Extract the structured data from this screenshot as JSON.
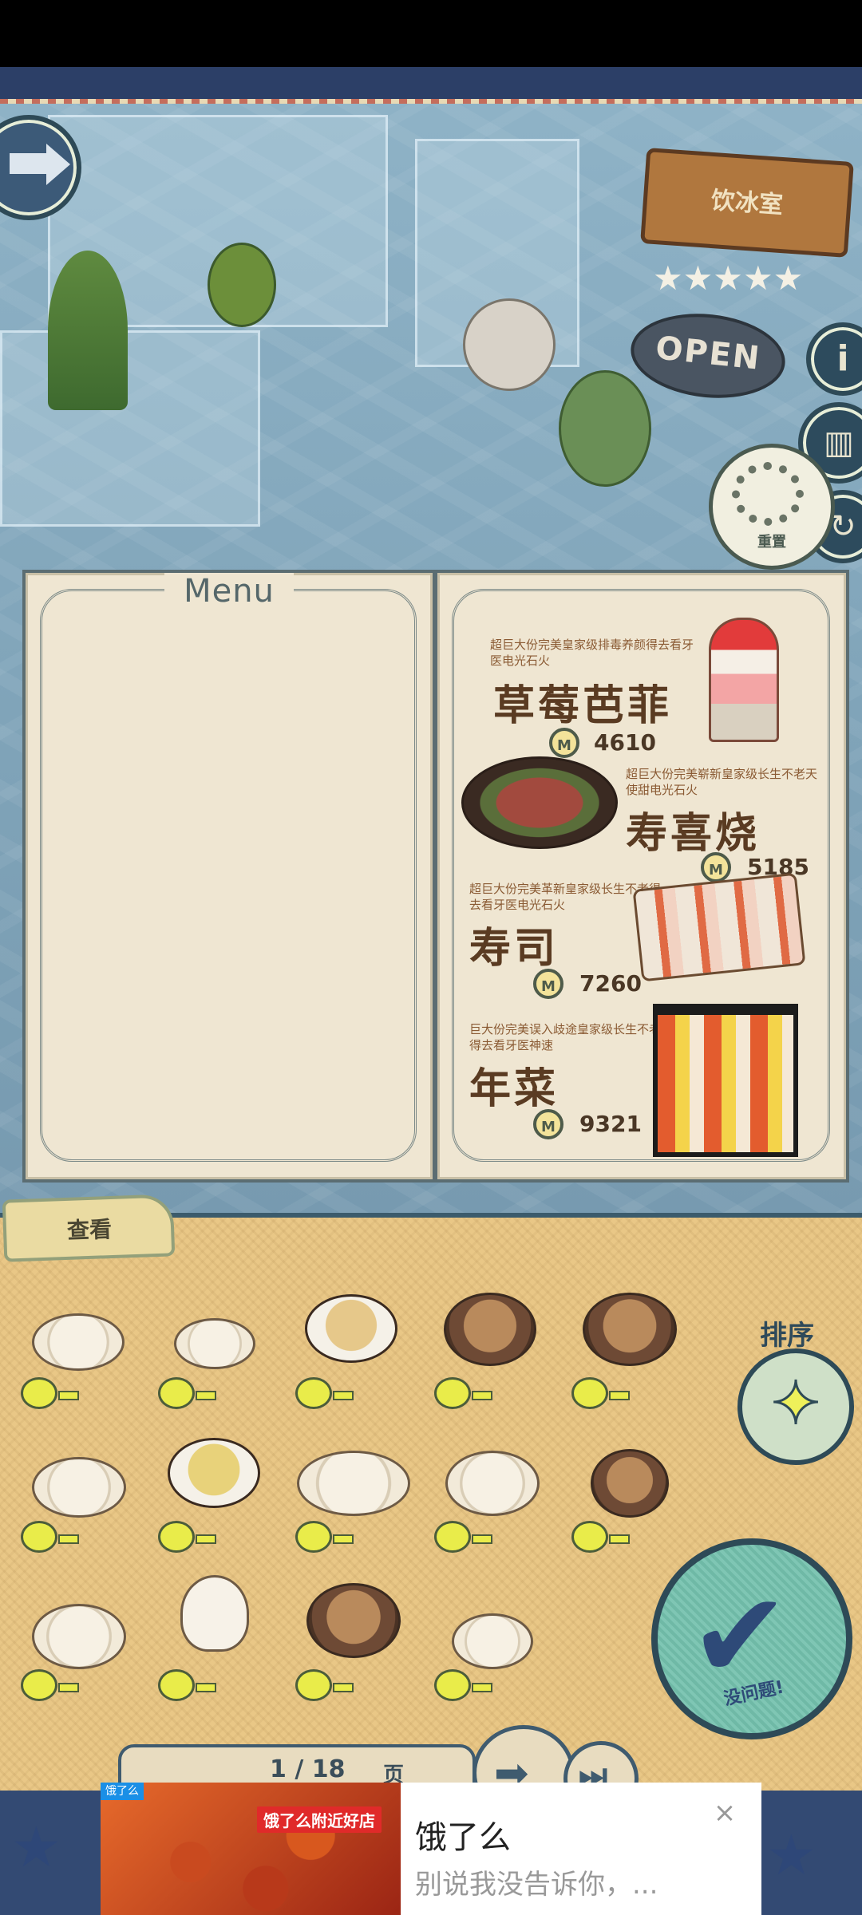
{
  "scene": {
    "shop_sign": "饮冰室",
    "open_sign": "OPEN",
    "reset_label": "重置"
  },
  "menu": {
    "title": "Menu",
    "items": [
      {
        "desc": "超巨大份完美皇家级排毒养颜得去看牙医电光石火",
        "name": "草莓芭菲",
        "price": "4610"
      },
      {
        "desc": "超巨大份完美崭新皇家级长生不老天使甜电光石火",
        "name": "寿喜烧",
        "price": "5185"
      },
      {
        "desc": "超巨大份完美革新皇家级长生不老得去看牙医电光石火",
        "name": "寿司",
        "price": "7260"
      },
      {
        "desc": "巨大份完美误入歧途皇家级长生不老得去看牙医神速",
        "name": "年菜",
        "price": "9321"
      }
    ]
  },
  "tray": {
    "tab_label": "查看",
    "sort_label": "排序",
    "confirm_label": "没问题!",
    "page": {
      "current": "1",
      "total": "18",
      "text": "1 / 18",
      "suffix": "页"
    }
  },
  "ad": {
    "badge": "饿了么",
    "image_tag": "饿了么附近好店",
    "title": "饿了么",
    "subtitle": "别说我没告诉你，...",
    "close": "×"
  },
  "colors": {
    "menu_paper": "#efe6d2",
    "tray": "#e9c786",
    "accent_navy": "#2e4a57",
    "coin": "#f3e39a"
  }
}
